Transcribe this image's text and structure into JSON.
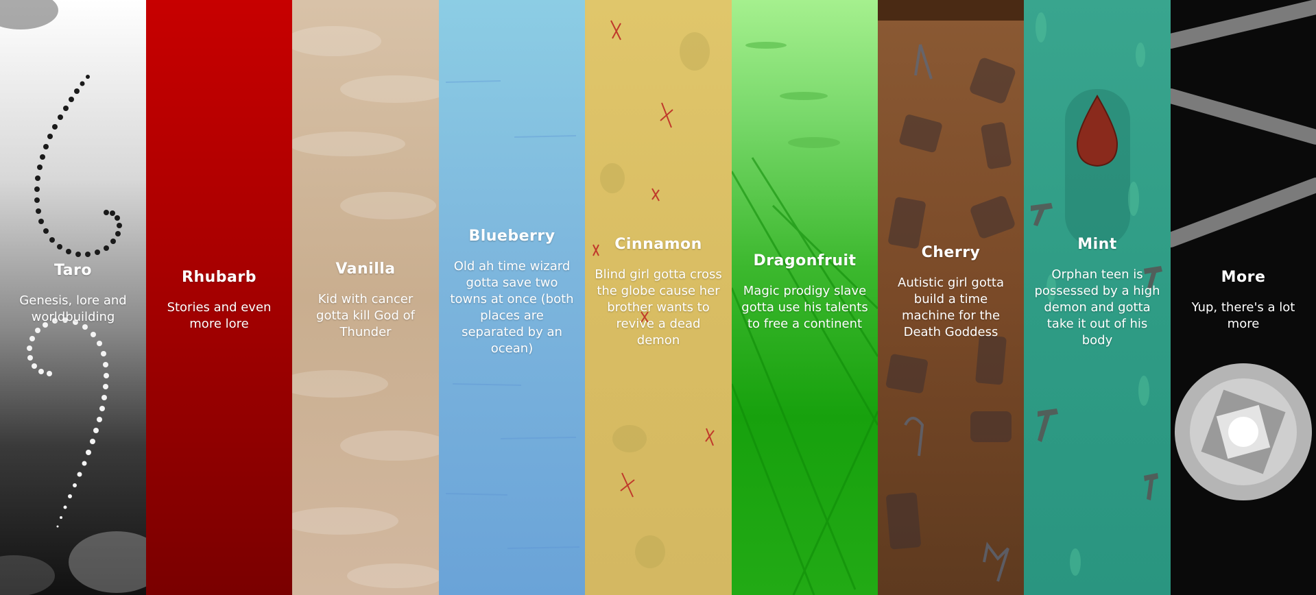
{
  "panels": [
    {
      "id": "taro",
      "title": "Taro",
      "desc": "Genesis, lore and worldbuilding",
      "color": "#e0e0e0"
    },
    {
      "id": "rhubarb",
      "title": "Rhubarb",
      "desc": "Stories and even more lore",
      "color": "#b00000"
    },
    {
      "id": "vanilla",
      "title": "Vanilla",
      "desc": "Kid with cancer gotta kill God of Thunder",
      "color": "#d0b89c"
    },
    {
      "id": "blueberry",
      "title": "Blueberry",
      "desc": "Old ah time wizard gotta save two towns at once (both places are separated by an ocean)",
      "color": "#7db6dd"
    },
    {
      "id": "cinnamon",
      "title": "Cinnamon",
      "desc": "Blind girl gotta cross the globe cause her brother wants to revive a dead demon",
      "color": "#dcc266"
    },
    {
      "id": "dragonfruit",
      "title": "Dragonfruit",
      "desc": "Magic prodigy slave gotta use his talents to free a continent",
      "color": "#3cb82e"
    },
    {
      "id": "cherry",
      "title": "Cherry",
      "desc": "Autistic girl gotta build a time machine for the Death Goddess",
      "color": "#7a4a28"
    },
    {
      "id": "mint",
      "title": "Mint",
      "desc": "Orphan teen is possessed by a high demon and gotta take it out of his body",
      "color": "#2f9c85"
    },
    {
      "id": "more",
      "title": "More",
      "desc": "Yup, there's a lot more",
      "color": "#0a0a0a"
    }
  ]
}
